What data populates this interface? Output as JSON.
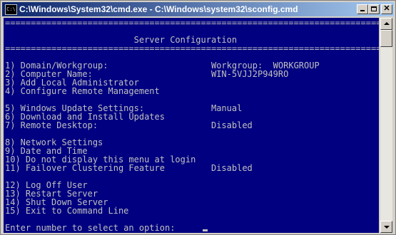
{
  "window": {
    "title": "C:\\Windows\\System32\\cmd.exe - C:\\Windows\\system32\\sconfig.cmd",
    "icon": "cmd-app-icon",
    "icon_text": "C:\\"
  },
  "console": {
    "lines": [
      "===============================================================================",
      "                         Server Configuration",
      "===============================================================================",
      "",
      "1) Domain/Workgroup:                    Workgroup:  WORKGROUP",
      "2) Computer Name:                       WIN-5VJJ2P949RO",
      "3) Add Local Administrator",
      "4) Configure Remote Management",
      "",
      "5) Windows Update Settings:             Manual",
      "6) Download and Install Updates",
      "7) Remote Desktop:                      Disabled",
      "",
      "8) Network Settings",
      "9) Date and Time",
      "10) Do not display this menu at login",
      "11) Failover Clustering Feature         Disabled",
      "",
      "12) Log Off User",
      "13) Restart Server",
      "14) Shut Down Server",
      "15) Exit to Command Line",
      "",
      "Enter number to select an option: "
    ]
  },
  "colors": {
    "console_background": "#000080",
    "console_text": "#c0c0c0",
    "titlebar_start": "#0a246a",
    "titlebar_end": "#a6caf0"
  }
}
